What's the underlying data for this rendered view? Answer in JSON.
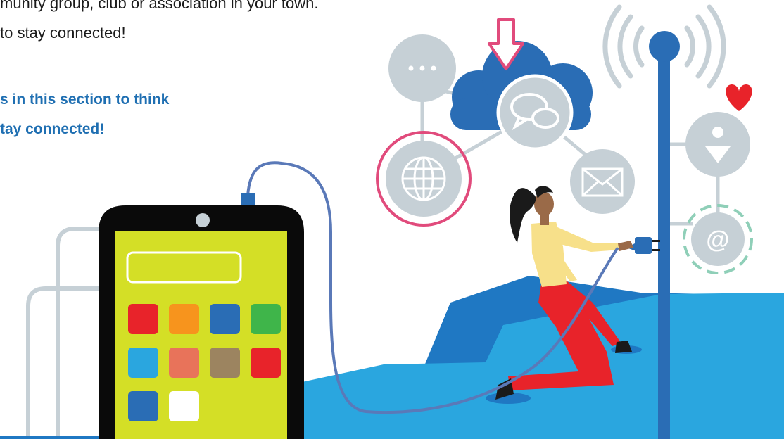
{
  "text": {
    "line1": "munity group, club or association in your town.",
    "line2": "to stay connected!",
    "highlight1": "s in this section to think",
    "highlight2": "tay connected!"
  },
  "icons": {
    "chat": "speech-bubble-icon",
    "globe": "globe-icon",
    "mail": "envelope-icon",
    "person": "person-icon",
    "at": "at-sign-icon",
    "heart": "heart-icon",
    "wifi": "wifi-signal-icon",
    "download": "download-arrow-icon",
    "more": "ellipsis-icon"
  },
  "at_symbol": "@",
  "colors": {
    "brand_blue": "#1f6fb2",
    "ground": "#2aa6df",
    "ground_dark": "#1f78c3",
    "phone_screen": "#d4df26",
    "node_gray": "#c6d0d6",
    "heart": "#e8232a",
    "pink_ring": "#e14b7c",
    "teal_ring": "#8fcfb8"
  },
  "app_tile_colors": [
    "#e8232a",
    "#f7941d",
    "#2a6db5",
    "#3fb54a",
    "#2aa6df",
    "#e8735a",
    "#9c8460",
    "#e8232a",
    "#2a6db5",
    "#ffffff"
  ]
}
